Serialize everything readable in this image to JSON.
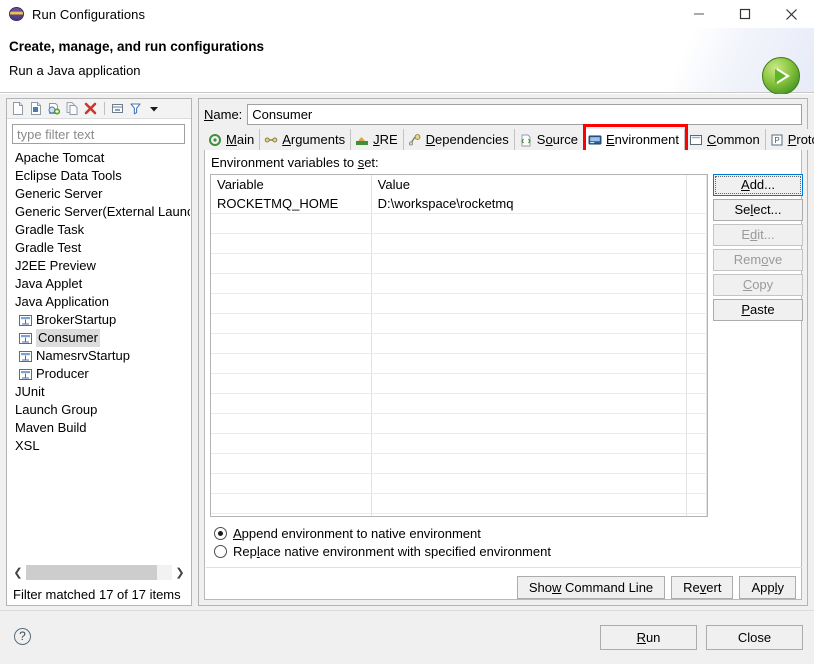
{
  "window": {
    "title": "Run Configurations",
    "icon": "eclipse-globe-icon",
    "minimize_label": "Minimize",
    "maximize_label": "Maximize",
    "close_label": "Close"
  },
  "header": {
    "title": "Create, manage, and run configurations",
    "subtitle": "Run a Java application",
    "badge_icon": "run-green-play-icon"
  },
  "tree_toolbar": {
    "icons": [
      "new-configuration-icon",
      "new-prototype-icon",
      "export-icon",
      "duplicate-icon",
      "delete-icon",
      "collapse-all-icon",
      "filter-icon",
      "view-menu-icon"
    ]
  },
  "filter": {
    "placeholder": "type filter text",
    "value": "",
    "status": "Filter matched 17 of 17 items"
  },
  "tree": {
    "items": [
      {
        "label": "Apache Tomcat",
        "type": "category",
        "selected": false
      },
      {
        "label": "Eclipse Data Tools",
        "type": "category",
        "selected": false
      },
      {
        "label": "Generic Server",
        "type": "category",
        "selected": false
      },
      {
        "label": "Generic Server(External Launch)",
        "type": "category",
        "selected": false
      },
      {
        "label": "Gradle Task",
        "type": "category",
        "selected": false
      },
      {
        "label": "Gradle Test",
        "type": "category",
        "selected": false
      },
      {
        "label": "J2EE Preview",
        "type": "category",
        "selected": false
      },
      {
        "label": "Java Applet",
        "type": "category",
        "selected": false
      },
      {
        "label": "Java Application",
        "type": "category",
        "selected": false
      },
      {
        "label": "BrokerStartup",
        "type": "config",
        "selected": false
      },
      {
        "label": "Consumer",
        "type": "config",
        "selected": true
      },
      {
        "label": "NamesrvStartup",
        "type": "config",
        "selected": false
      },
      {
        "label": "Producer",
        "type": "config",
        "selected": false
      },
      {
        "label": "JUnit",
        "type": "category",
        "selected": false
      },
      {
        "label": "Launch Group",
        "type": "category",
        "selected": false
      },
      {
        "label": "Maven Build",
        "type": "category",
        "selected": false
      },
      {
        "label": "XSL",
        "type": "category",
        "selected": false
      }
    ]
  },
  "name_field": {
    "label": "Name:",
    "label_mnemonic": "N",
    "label_rest": "ame:",
    "value": "Consumer"
  },
  "tabs": [
    {
      "label": "Main",
      "icon": "main-target-icon",
      "active": false
    },
    {
      "label": "Arguments",
      "icon": "arguments-icon",
      "active": false
    },
    {
      "label": "JRE",
      "icon": "jre-icon",
      "active": false
    },
    {
      "label": "Dependencies",
      "icon": "dependencies-icon",
      "active": false
    },
    {
      "label": "Source",
      "icon": "source-icon",
      "active": false
    },
    {
      "label": "Environment",
      "icon": "environment-icon",
      "active": true
    },
    {
      "label": "Common",
      "icon": "common-icon",
      "active": false
    },
    {
      "label": "Prototype",
      "icon": "prototype-icon",
      "active": false
    }
  ],
  "highlight": {
    "target": "Environment",
    "color": "#ff0000"
  },
  "environment": {
    "section_label": "Environment variables to set:",
    "columns": [
      "Variable",
      "Value"
    ],
    "rows": [
      {
        "variable": "ROCKETMQ_HOME",
        "value": "D:\\workspace\\rocketmq"
      }
    ],
    "buttons": [
      {
        "label": "Add...",
        "mnemonic": "A",
        "enabled": true,
        "focused": true
      },
      {
        "label": "Select...",
        "mnemonic": "l",
        "enabled": true,
        "focused": false
      },
      {
        "label": "Edit...",
        "mnemonic": "d",
        "enabled": false,
        "focused": false
      },
      {
        "label": "Remove",
        "mnemonic": "o",
        "enabled": false,
        "focused": false
      },
      {
        "label": "Copy",
        "mnemonic": "C",
        "enabled": false,
        "focused": false
      },
      {
        "label": "Paste",
        "mnemonic": "P",
        "enabled": true,
        "focused": false
      }
    ],
    "radios": [
      {
        "label": "Append environment to native environment",
        "checked": true
      },
      {
        "label": "Replace native environment with specified environment",
        "checked": false
      }
    ]
  },
  "action_bar": {
    "show_command_line": "Show Command Line",
    "revert": "Revert",
    "apply": "Apply"
  },
  "footer": {
    "help_icon": "help-question-icon",
    "run": "Run",
    "close": "Close"
  }
}
